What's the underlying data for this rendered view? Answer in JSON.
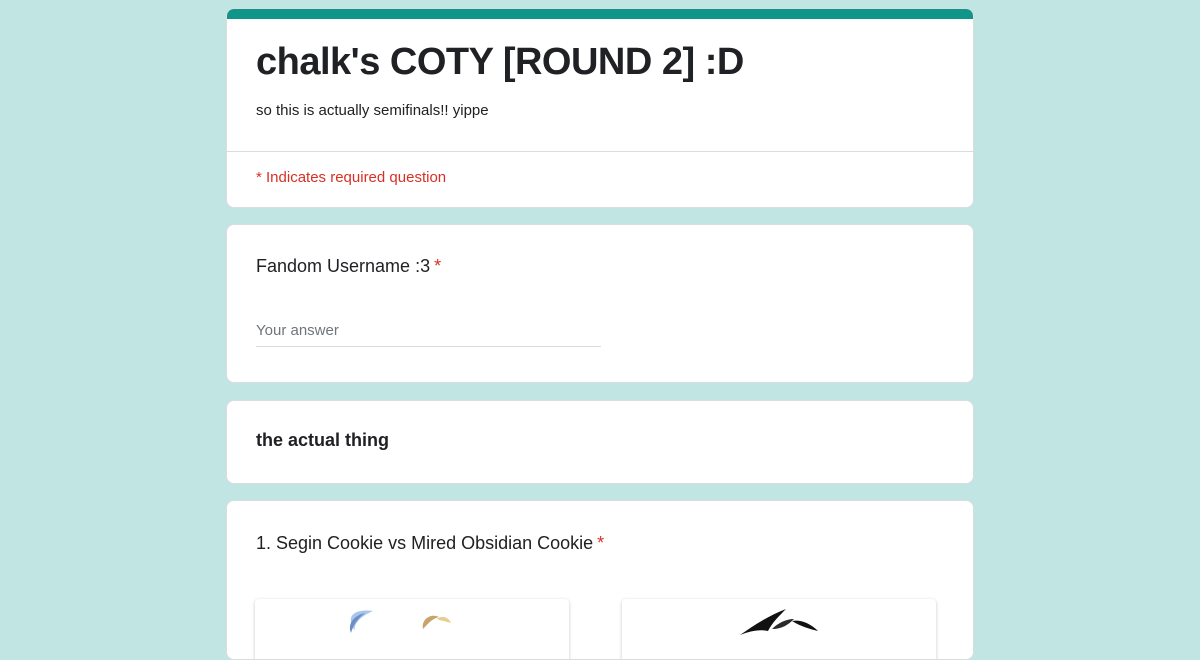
{
  "form": {
    "title": "chalk's COTY [ROUND 2] :D",
    "description": "so this is actually semifinals!! yippe",
    "required_note": "* Indicates required question",
    "accent_color": "#10958a",
    "background_color": "#c0e5e3"
  },
  "questions": [
    {
      "label": "Fandom Username :3",
      "required_mark": "*",
      "placeholder": "Your answer",
      "value": ""
    },
    {
      "label": "1. Segin Cookie vs Mired Obsidian Cookie",
      "required_mark": "*",
      "options": [
        {
          "image_icon": "segin-cookie-image"
        },
        {
          "image_icon": "mired-obsidian-cookie-image"
        }
      ]
    }
  ],
  "section": {
    "title": "the actual thing"
  }
}
